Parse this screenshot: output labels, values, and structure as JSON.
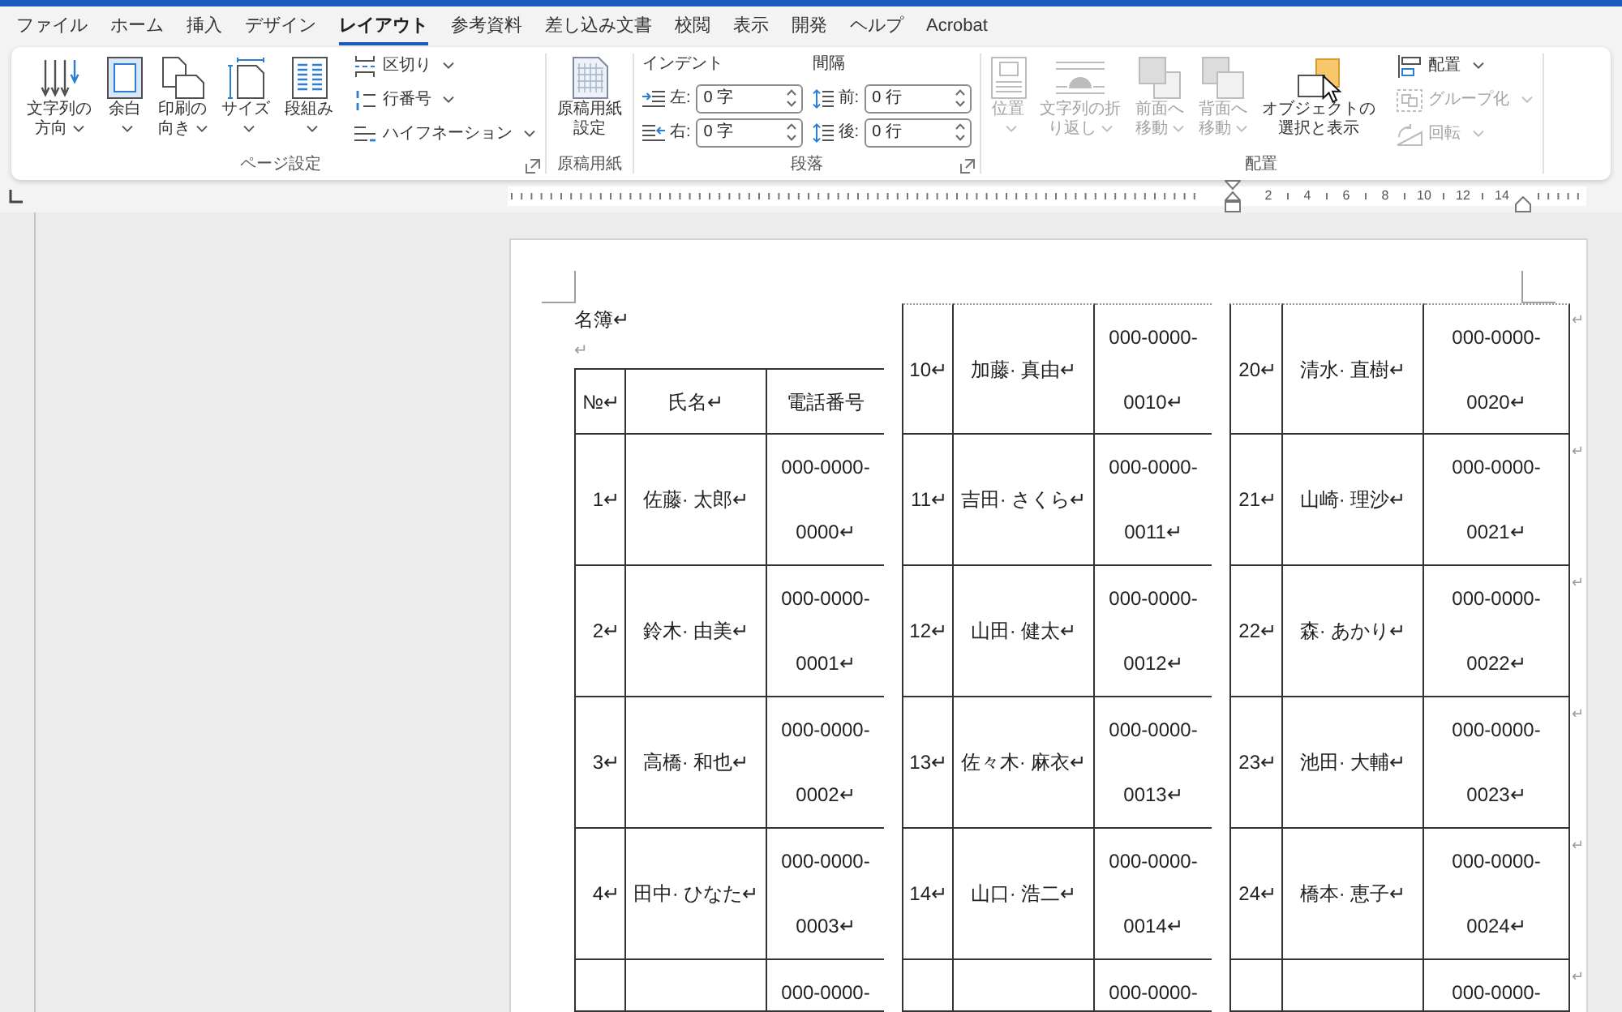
{
  "tabs": [
    {
      "label": "ファイル",
      "selected": false
    },
    {
      "label": "ホーム",
      "selected": false
    },
    {
      "label": "挿入",
      "selected": false
    },
    {
      "label": "デザイン",
      "selected": false
    },
    {
      "label": "レイアウト",
      "selected": true
    },
    {
      "label": "参考資料",
      "selected": false
    },
    {
      "label": "差し込み文書",
      "selected": false
    },
    {
      "label": "校閲",
      "selected": false
    },
    {
      "label": "表示",
      "selected": false
    },
    {
      "label": "開発",
      "selected": false
    },
    {
      "label": "ヘルプ",
      "selected": false
    },
    {
      "label": "Acrobat",
      "selected": false
    }
  ],
  "ribbon": {
    "groups": [
      {
        "kind": "layout",
        "label": "ページ設定",
        "launcher": true,
        "large_buttons": [
          {
            "label": "文字列の方向",
            "dropdown": true
          },
          {
            "label": "余白",
            "dropdown": true
          },
          {
            "label": "印刷の向き",
            "dropdown": true
          },
          {
            "label": "サイズ",
            "dropdown": true
          },
          {
            "label": "段組み",
            "dropdown": true
          }
        ],
        "small_buttons": [
          {
            "label": "区切り",
            "dropdown": true
          },
          {
            "label": "行番号",
            "dropdown": true
          },
          {
            "label": "ハイフネーション",
            "dropdown": true
          }
        ]
      },
      {
        "kind": "manuscript",
        "label": "原稿用紙",
        "launcher": false,
        "large_buttons": [
          {
            "label": "原稿用紙設定",
            "dropdown": false
          }
        ]
      },
      {
        "kind": "paragraph",
        "label": "段落",
        "launcher": true,
        "indent": {
          "title": "インデント",
          "fields": [
            {
              "label": "左:",
              "value": "0 字"
            },
            {
              "label": "右:",
              "value": "0 字"
            }
          ]
        },
        "spacing": {
          "title": "間隔",
          "fields": [
            {
              "label": "前:",
              "value": "0 行"
            },
            {
              "label": "後:",
              "value": "0 行"
            }
          ]
        }
      },
      {
        "kind": "arrange",
        "label": "配置",
        "launcher": false,
        "large_buttons": [
          {
            "label": "位置",
            "dropdown": true,
            "disabled": true,
            "hovered": false
          },
          {
            "label": "文字列の折り返し",
            "dropdown": true,
            "disabled": true,
            "hovered": false
          },
          {
            "label": "前面へ移動",
            "dropdown": true,
            "disabled": true,
            "hovered": false
          },
          {
            "label": "背面へ移動",
            "dropdown": true,
            "disabled": true,
            "hovered": false
          },
          {
            "label": "オブジェクトの選択と表示",
            "dropdown": false,
            "disabled": false,
            "hovered": true
          }
        ],
        "small_buttons": [
          {
            "label": "配置",
            "dropdown": true,
            "disabled": false
          },
          {
            "label": "グループ化",
            "dropdown": true,
            "disabled": true
          },
          {
            "label": "回転",
            "dropdown": true,
            "disabled": true
          }
        ]
      }
    ]
  },
  "ruler": {
    "numbers": [
      "2",
      "4",
      "6",
      "8",
      "10",
      "12",
      "14"
    ]
  },
  "document": {
    "sections": [
      {
        "title": "名簿↵",
        "blank_line": "↵",
        "header": [
          "№↵",
          "氏名↵",
          "電話番号"
        ],
        "continued": false,
        "cut_off": true,
        "rows": [
          {
            "no": "1↵",
            "name": "佐藤· 太郎↵",
            "phone": "000-0000-\n0000↵"
          },
          {
            "no": "2↵",
            "name": "鈴木· 由美↵",
            "phone": "000-0000-\n0001↵"
          },
          {
            "no": "3↵",
            "name": "高橋· 和也↵",
            "phone": "000-0000-\n0002↵"
          },
          {
            "no": "4↵",
            "name": "田中· ひなた↵",
            "phone": "000-0000-\n0003↵"
          },
          {
            "phone": "000-0000-"
          }
        ]
      },
      {
        "continued": true,
        "cut_off": true,
        "rows": [
          {
            "no": "10↵",
            "name": "加藤· 真由↵",
            "phone": "000-0000-\n0010↵"
          },
          {
            "no": "11↵",
            "name": "吉田· さくら↵",
            "phone": "000-0000-\n0011↵"
          },
          {
            "no": "12↵",
            "name": "山田· 健太↵",
            "phone": "000-0000-\n0012↵"
          },
          {
            "no": "13↵",
            "name": "佐々木· 麻衣↵",
            "phone": "000-0000-\n0013↵"
          },
          {
            "no": "14↵",
            "name": "山口· 浩二↵",
            "phone": "000-0000-\n0014↵"
          },
          {
            "phone": "000-0000-"
          }
        ]
      },
      {
        "continued": true,
        "cut_off": false,
        "rows": [
          {
            "no": "20↵",
            "name": "清水· 直樹↵",
            "phone": "000-0000-\n0020↵",
            "end_mark": "↵"
          },
          {
            "no": "21↵",
            "name": "山崎· 理沙↵",
            "phone": "000-0000-\n0021↵",
            "end_mark": "↵"
          },
          {
            "no": "22↵",
            "name": "森· あかり↵",
            "phone": "000-0000-\n0022↵",
            "end_mark": "↵"
          },
          {
            "no": "23↵",
            "name": "池田· 大輔↵",
            "phone": "000-0000-\n0023↵",
            "end_mark": "↵"
          },
          {
            "no": "24↵",
            "name": "橋本· 恵子↵",
            "phone": "000-0000-\n0024↵",
            "end_mark": "↵"
          },
          {
            "phone": "000-0000-",
            "end_mark": "↵"
          }
        ]
      }
    ]
  }
}
